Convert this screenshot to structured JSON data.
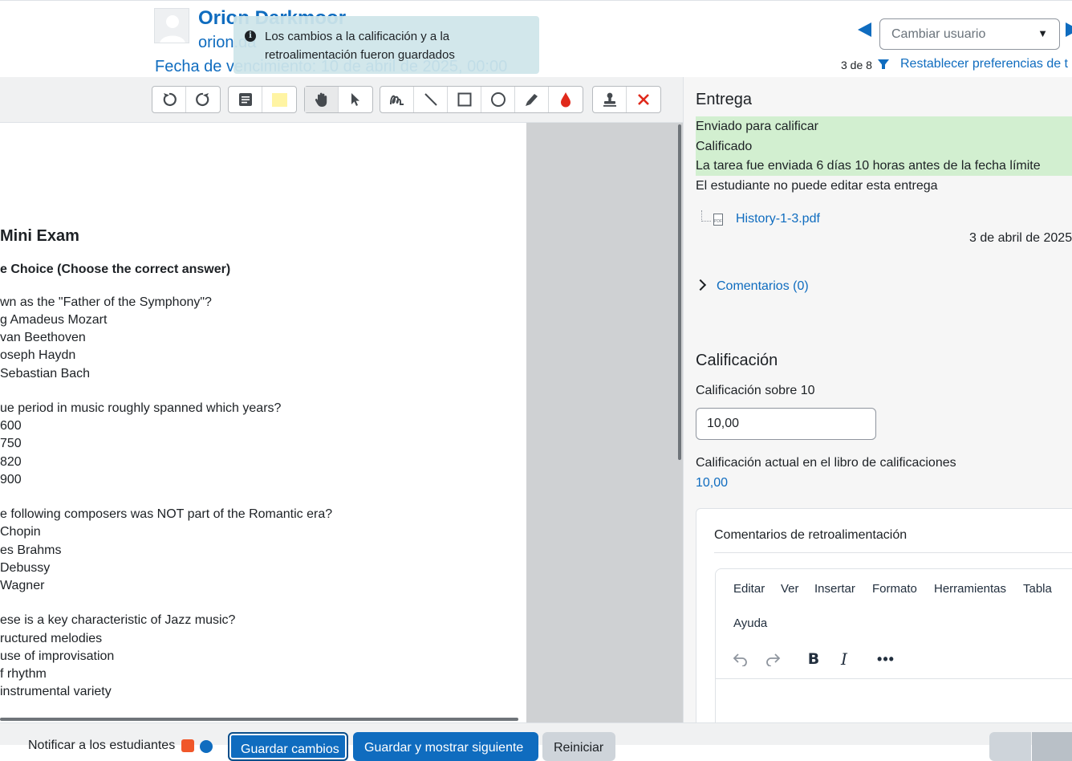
{
  "header": {
    "user_name": "Orion Darkmoor",
    "user_email": "orion.da",
    "due_date": "Fecha de vencimiento: 10 de abril de 2025, 00:00",
    "change_user_placeholder": "Cambiar usuario",
    "page_count": "3 de 8",
    "reset_prefs": "Restablecer preferencias de t"
  },
  "toast": {
    "message": "Los cambios a la calificación y a la retroalimentación fueron guardados"
  },
  "document": {
    "title": "Mini Exam",
    "section": "e Choice (Choose the correct answer)",
    "lines": [
      "wn as the \"Father of the Symphony\"?",
      "g Amadeus Mozart",
      "van Beethoven",
      "oseph Haydn",
      "Sebastian Bach",
      "ue period in music roughly spanned which years?",
      "600",
      "750",
      "820",
      "900",
      "e following composers was NOT part of the Romantic era?",
      "Chopin",
      "es Brahms",
      "Debussy",
      "Wagner",
      "ese is a key characteristic of Jazz music?",
      "ructured melodies",
      "use of improvisation",
      "f rhythm",
      "instrumental variety"
    ]
  },
  "toolbar": {
    "icons": [
      "rotate-left-icon",
      "rotate-right-icon",
      "comment-icon",
      "comment-color-icon",
      "pan-hand-icon",
      "select-arrow-icon",
      "pen-icon",
      "line-icon",
      "rectangle-icon",
      "oval-icon",
      "highlight-icon",
      "annotation-color-icon",
      "stamp-icon",
      "delete-icon"
    ]
  },
  "submission": {
    "heading": "Entrega",
    "status_submitted": "Enviado para calificar",
    "status_graded": "Calificado",
    "status_timing": "La tarea fue enviada 6 días 10 horas antes de la fecha límite",
    "status_editing": "El estudiante no puede editar esta entrega",
    "file_name": "History-1-3.pdf",
    "submitted_date": "3 de abril de 2025",
    "comments_link": "Comentarios (0)"
  },
  "grading": {
    "heading": "Calificación",
    "grade_label": "Calificación sobre 10",
    "grade_value": "10,00",
    "current_grade_label": "Calificación actual en el libro de calificaciones",
    "current_grade_value": "10,00",
    "feedback_title": "Comentarios de retroalimentación"
  },
  "editor": {
    "menu": [
      "Editar",
      "Ver",
      "Insertar",
      "Formato",
      "Herramientas",
      "Tabla",
      "Ayuda"
    ],
    "bold": "B",
    "italic": "I",
    "more": "•••"
  },
  "footer": {
    "notify_label": "Notificar a los estudiantes",
    "save_label": "Guardar cambios",
    "save_next_label": "Guardar y mostrar siguiente",
    "reset_label": "Reiniciar"
  },
  "colors": {
    "link": "#0f6cbf",
    "status_green": "#d2efd0",
    "toast_bg": "#cfe5ea",
    "color_swatch_yellow": "#fff4a3",
    "annotation_red": "#e0291b",
    "delete_red": "#e0291b"
  }
}
